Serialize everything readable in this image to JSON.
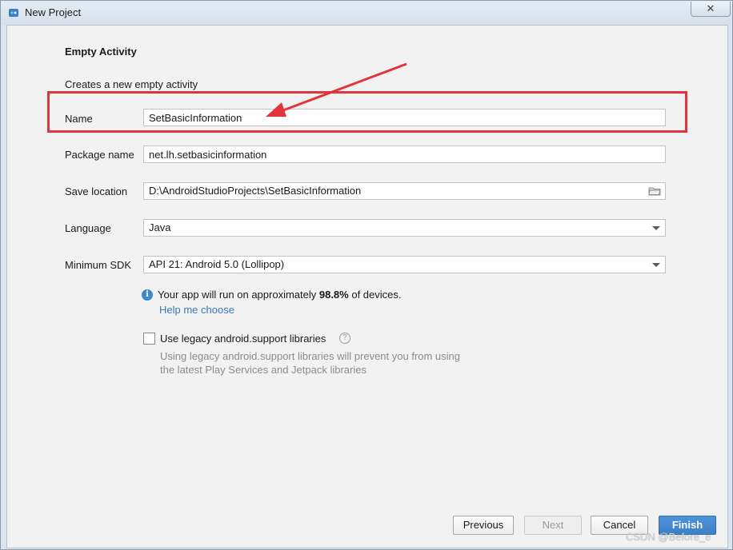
{
  "window": {
    "title": "New Project",
    "close_label": "✕"
  },
  "page": {
    "heading": "Empty Activity",
    "subheading": "Creates a new empty activity"
  },
  "form": {
    "name_label": "Name",
    "name_value": "SetBasicInformation",
    "package_label": "Package name",
    "package_value": "net.lh.setbasicinformation",
    "location_label": "Save location",
    "location_value": "D:\\AndroidStudioProjects\\SetBasicInformation",
    "language_label": "Language",
    "language_value": "Java",
    "sdk_label": "Minimum SDK",
    "sdk_value": "API 21: Android 5.0 (Lollipop)"
  },
  "info": {
    "prefix": "Your app will run on approximately ",
    "percent": "98.8%",
    "suffix": " of devices.",
    "help_link": "Help me choose"
  },
  "legacy": {
    "checkbox_label": "Use legacy android.support libraries",
    "checked": false,
    "desc_line1": "Using legacy android.support libraries will prevent you from using",
    "desc_line2": "the latest Play Services and Jetpack libraries"
  },
  "buttons": {
    "previous": "Previous",
    "next": "Next",
    "cancel": "Cancel",
    "finish": "Finish"
  },
  "watermark": "CSDN @Before_e",
  "colors": {
    "annotation_red": "#e2343a",
    "primary_blue": "#3b80c8",
    "link_blue": "#3a77b8"
  },
  "icons": [
    "android-studio-icon",
    "folder-icon",
    "dropdown-caret-icon",
    "info-icon",
    "question-icon",
    "annotation-arrow"
  ]
}
